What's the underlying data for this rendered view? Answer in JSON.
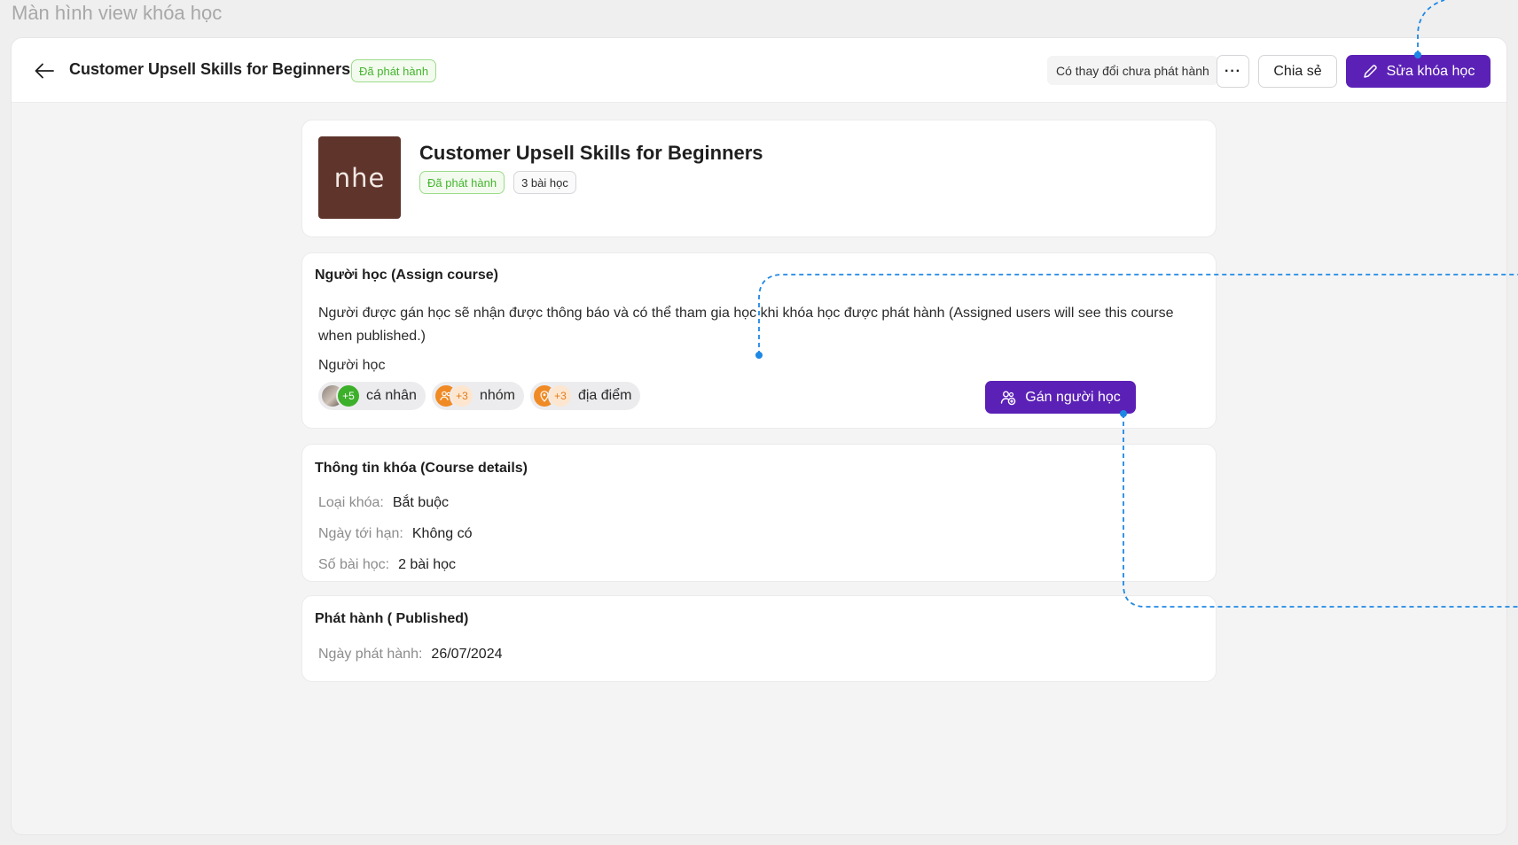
{
  "screen_caption": "Màn hình view khóa học",
  "header": {
    "title": "Customer Upsell Skills for Beginners",
    "status_badge": "Đã phát hành",
    "unpublished_changes": "Có thay đổi chưa phát hành",
    "more_label": "···",
    "share_label": "Chia sẻ",
    "edit_label": "Sửa khóa học"
  },
  "course": {
    "thumbnail_text": "nhe",
    "title": "Customer Upsell Skills for Beginners",
    "status_badge": "Đã phát hành",
    "lesson_badge": "3 bài học"
  },
  "assign": {
    "heading": "Người học (Assign course)",
    "description": "Người được gán học sẽ nhận được thông báo và có thể tham gia học khi khóa học được phát hành (Assigned users will see this course when published.)",
    "learners_label": "Người học",
    "chips": [
      {
        "count": "+5",
        "label": "cá nhân"
      },
      {
        "count": "+3",
        "label": "nhóm"
      },
      {
        "count": "+3",
        "label": "địa điểm"
      }
    ],
    "assign_button": "Gán người học"
  },
  "details": {
    "heading": "Thông tin khóa (Course details)",
    "rows": [
      {
        "key": "Loại khóa:",
        "value": "Bắt buộc"
      },
      {
        "key": "Ngày tới hạn:",
        "value": "Không có"
      },
      {
        "key": "Số bài học:",
        "value": "2 bài học"
      }
    ]
  },
  "published": {
    "heading": "Phát hành ( Published)",
    "date_key": "Ngày phát hành:",
    "date_value": "26/07/2024"
  },
  "colors": {
    "primary": "#5b21b6",
    "success": "#45b52e",
    "connector": "#1e88e5"
  }
}
